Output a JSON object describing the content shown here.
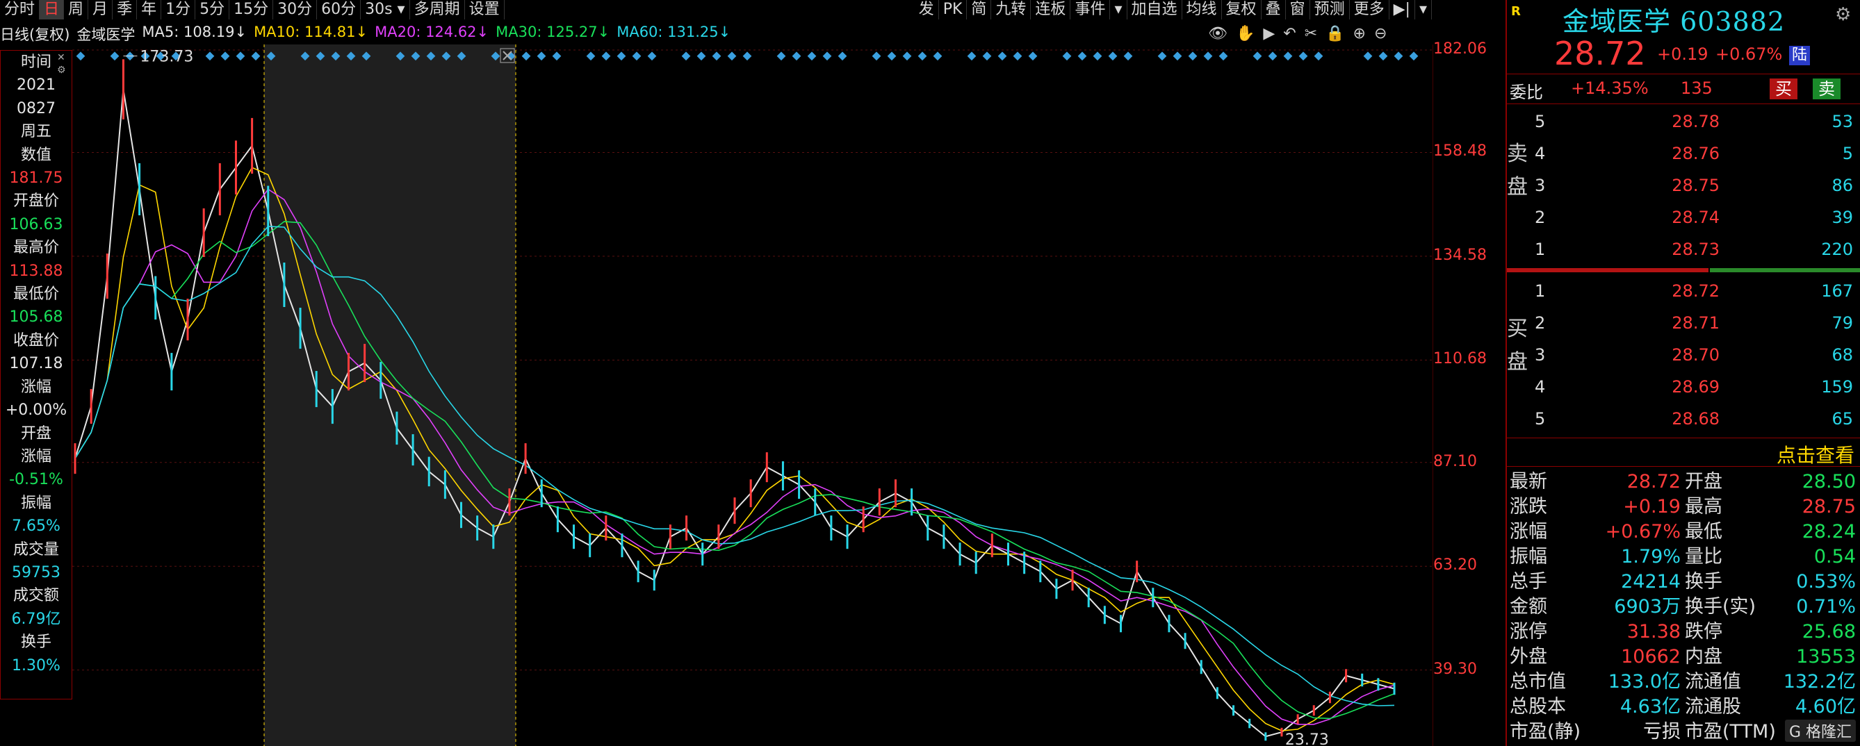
{
  "toolbar": {
    "left": [
      "分时",
      "日",
      "周",
      "月",
      "季",
      "年",
      "1分",
      "5分",
      "15分",
      "30分",
      "60分",
      "30s ▾",
      "多周期",
      "设置"
    ],
    "active_index": 1,
    "right": [
      "发",
      "PK",
      "简",
      "九转",
      "连板",
      "事件",
      "▾",
      "加自选",
      "均线",
      "复权",
      "叠",
      "窗",
      "预测",
      "更多",
      "▶|",
      "▾"
    ]
  },
  "ma_legend": {
    "prefix": "日线(复权)",
    "name": "金域医学",
    "items": [
      {
        "label": "MA5: 108.19↓",
        "color": "#e6e6e6"
      },
      {
        "label": "MA10: 114.81↓",
        "color": "#ffd700"
      },
      {
        "label": "MA20: 124.62↓",
        "color": "#e040fb"
      },
      {
        "label": "MA30: 125.27↓",
        "color": "#19e05a"
      },
      {
        "label": "MA60: 131.25↓",
        "color": "#29d7e8"
      }
    ]
  },
  "chart_icons": [
    "eye-icon",
    "hand-icon",
    "play-icon",
    "undo-icon",
    "scissors-icon",
    "lock-icon",
    "zoom-in-icon",
    "zoom-out-icon"
  ],
  "left_panel": [
    {
      "t": "时间",
      "c": "wht"
    },
    {
      "t": "2021",
      "c": "wht"
    },
    {
      "t": "0827",
      "c": "wht"
    },
    {
      "t": "周五",
      "c": "wht"
    },
    {
      "t": "数值",
      "c": "wht"
    },
    {
      "t": "181.75",
      "c": "red"
    },
    {
      "t": "开盘价",
      "c": "wht"
    },
    {
      "t": "106.63",
      "c": "grn"
    },
    {
      "t": "最高价",
      "c": "wht"
    },
    {
      "t": "113.88",
      "c": "red"
    },
    {
      "t": "最低价",
      "c": "wht"
    },
    {
      "t": "105.68",
      "c": "grn"
    },
    {
      "t": "收盘价",
      "c": "wht"
    },
    {
      "t": "107.18",
      "c": "wht"
    },
    {
      "t": "涨幅",
      "c": "wht"
    },
    {
      "t": "+0.00%",
      "c": "wht"
    },
    {
      "t": "开盘",
      "c": "wht"
    },
    {
      "t": "涨幅",
      "c": "wht"
    },
    {
      "t": "-0.51%",
      "c": "grn"
    },
    {
      "t": "振幅",
      "c": "wht"
    },
    {
      "t": "7.65%",
      "c": "cyn"
    },
    {
      "t": "成交量",
      "c": "wht"
    },
    {
      "t": "59753",
      "c": "cyn"
    },
    {
      "t": "成交额",
      "c": "wht"
    },
    {
      "t": "6.79亿",
      "c": "cyn"
    },
    {
      "t": "换手",
      "c": "wht"
    },
    {
      "t": "1.30%",
      "c": "cyn"
    }
  ],
  "axis": {
    "labels": [
      "182.06",
      "158.48",
      "134.58",
      "110.68",
      "87.10",
      "63.20",
      "39.30"
    ]
  },
  "chart_data": {
    "type": "line",
    "ylim": [
      23.73,
      182.06
    ],
    "y_ticks": [
      182.06,
      158.48,
      134.58,
      110.68,
      87.1,
      63.2,
      39.3
    ],
    "high_label": "173.73",
    "low_label": "23.73",
    "series": [
      {
        "color": "#e6e6e6",
        "values": [
          88,
          100,
          130,
          173,
          150,
          125,
          108,
          120,
          140,
          150,
          155,
          160,
          145,
          128,
          118,
          104,
          100,
          108,
          110,
          106,
          95,
          90,
          85,
          82,
          75,
          72,
          70,
          78,
          88,
          80,
          74,
          70,
          68,
          72,
          68,
          62,
          60,
          70,
          72,
          66,
          70,
          76,
          80,
          86,
          84,
          82,
          78,
          72,
          70,
          74,
          78,
          80,
          78,
          72,
          70,
          66,
          64,
          68,
          66,
          64,
          62,
          58,
          60,
          56,
          52,
          50,
          62,
          56,
          50,
          46,
          40,
          34,
          30,
          27,
          24,
          25,
          28,
          30,
          33,
          38,
          37,
          36,
          35
        ]
      }
    ]
  },
  "quote": {
    "badge": "R",
    "name": "金域医学 603882",
    "price": "28.72",
    "change": "+0.19",
    "pct": "+0.67%",
    "market": "陆",
    "weibi_label": "委比",
    "weibi": "+14.35%",
    "weicha": "135",
    "buy_btn": "买",
    "sell_btn": "卖",
    "sell_side": "卖盘",
    "buy_side": "买盘",
    "asks": [
      {
        "lvl": "5",
        "p": "28.78",
        "v": "53"
      },
      {
        "lvl": "4",
        "p": "28.76",
        "v": "5"
      },
      {
        "lvl": "3",
        "p": "28.75",
        "v": "86"
      },
      {
        "lvl": "2",
        "p": "28.74",
        "v": "39"
      },
      {
        "lvl": "1",
        "p": "28.73",
        "v": "220"
      }
    ],
    "bids": [
      {
        "lvl": "1",
        "p": "28.72",
        "v": "167"
      },
      {
        "lvl": "2",
        "p": "28.71",
        "v": "79"
      },
      {
        "lvl": "3",
        "p": "28.70",
        "v": "68"
      },
      {
        "lvl": "4",
        "p": "28.69",
        "v": "159"
      },
      {
        "lvl": "5",
        "p": "28.68",
        "v": "65"
      }
    ],
    "click_view": "点击查看",
    "stats": [
      {
        "k1": "最新",
        "v1": "28.72",
        "c1": "red",
        "k2": "开盘",
        "v2": "28.50",
        "c2": "grn"
      },
      {
        "k1": "涨跌",
        "v1": "+0.19",
        "c1": "red",
        "k2": "最高",
        "v2": "28.75",
        "c2": "red"
      },
      {
        "k1": "涨幅",
        "v1": "+0.67%",
        "c1": "red",
        "k2": "最低",
        "v2": "28.24",
        "c2": "grn"
      },
      {
        "k1": "振幅",
        "v1": "1.79%",
        "c1": "cyn",
        "k2": "量比",
        "v2": "0.54",
        "c2": "grn"
      },
      {
        "k1": "总手",
        "v1": "24214",
        "c1": "cyn",
        "k2": "换手",
        "v2": "0.53%",
        "c2": "cyn"
      },
      {
        "k1": "金额",
        "v1": "6903万",
        "c1": "cyn",
        "k2": "换手(实)",
        "v2": "0.71%",
        "c2": "cyn"
      },
      {
        "k1": "涨停",
        "v1": "31.38",
        "c1": "red",
        "k2": "跌停",
        "v2": "25.68",
        "c2": "grn"
      },
      {
        "k1": "外盘",
        "v1": "10662",
        "c1": "red",
        "k2": "内盘",
        "v2": "13553",
        "c2": "grn"
      },
      {
        "k1": "总市值",
        "v1": "133.0亿",
        "c1": "cyn",
        "k2": "流通值",
        "v2": "132.2亿",
        "c2": "cyn"
      },
      {
        "k1": "总股本",
        "v1": "4.63亿",
        "c1": "cyn",
        "k2": "流通股",
        "v2": "4.60亿",
        "c2": "cyn"
      },
      {
        "k1": "市盈(静)",
        "v1": "亏损",
        "c1": "wht",
        "k2": "市盈(TTM)",
        "v2": "",
        "c2": "wht"
      }
    ],
    "brand": "G 格隆汇"
  }
}
